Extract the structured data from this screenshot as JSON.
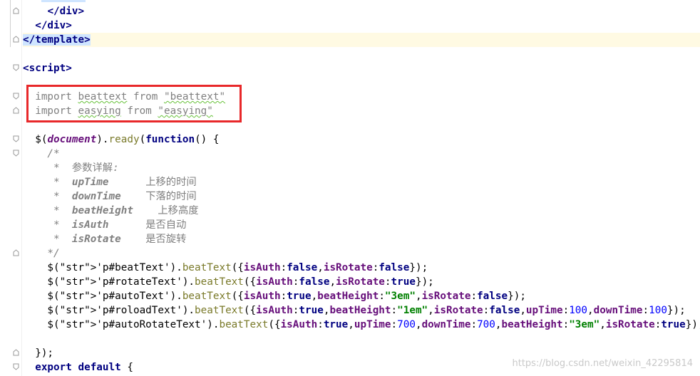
{
  "code": {
    "lines": [
      {
        "id": "l1",
        "text": "    </div>"
      },
      {
        "id": "l2",
        "text": "  </div>"
      },
      {
        "id": "l3",
        "text": "</template>"
      },
      {
        "id": "l4",
        "text": ""
      },
      {
        "id": "l5",
        "text": "<script>"
      },
      {
        "id": "l6",
        "text": ""
      },
      {
        "id": "l7",
        "text": "  import beattext from \"beattext\""
      },
      {
        "id": "l8",
        "text": "  import easying from \"easying\""
      },
      {
        "id": "l9",
        "text": ""
      },
      {
        "id": "l10",
        "text": "  $(document).ready(function() {"
      },
      {
        "id": "l11",
        "text": "    /*"
      },
      {
        "id": "l12",
        "text": "     *  参数详解:"
      },
      {
        "id": "l13",
        "text": "     *  upTime      上移的时间"
      },
      {
        "id": "l14",
        "text": "     *  downTime    下落的时间"
      },
      {
        "id": "l15",
        "text": "     *  beatHeight    上移高度"
      },
      {
        "id": "l16",
        "text": "     *  isAuth      是否自动"
      },
      {
        "id": "l17",
        "text": "     *  isRotate    是否旋转"
      },
      {
        "id": "l18",
        "text": "    */"
      },
      {
        "id": "l19",
        "text": "    $('p#beatText').beatText({isAuth:false,isRotate:false});"
      },
      {
        "id": "l20",
        "text": "    $('p#rotateText').beatText({isAuth:false,isRotate:true});"
      },
      {
        "id": "l21",
        "text": "    $('p#autoText').beatText({isAuth:true,beatHeight:\"3em\",isRotate:false});"
      },
      {
        "id": "l22",
        "text": "    $('p#roloadText').beatText({isAuth:true,beatHeight:\"1em\",isRotate:false,upTime:100,downTime:100});"
      },
      {
        "id": "l23",
        "text": "    $('p#autoRotateText').beatText({isAuth:true,upTime:700,downTime:700,beatHeight:\"3em\",isRotate:true});"
      },
      {
        "id": "l24",
        "text": ""
      },
      {
        "id": "l25",
        "text": "  });"
      },
      {
        "id": "l26",
        "text": "  export default {"
      }
    ]
  },
  "watermark": "https://blog.csdn.net/weixin_42295814",
  "colors": {
    "highlight_box": "#e8282a",
    "current_line": "#fffae3",
    "keyword": "#000080",
    "string": "#008000",
    "number": "#0000ff",
    "property": "#660e7a",
    "comment": "#808080"
  }
}
